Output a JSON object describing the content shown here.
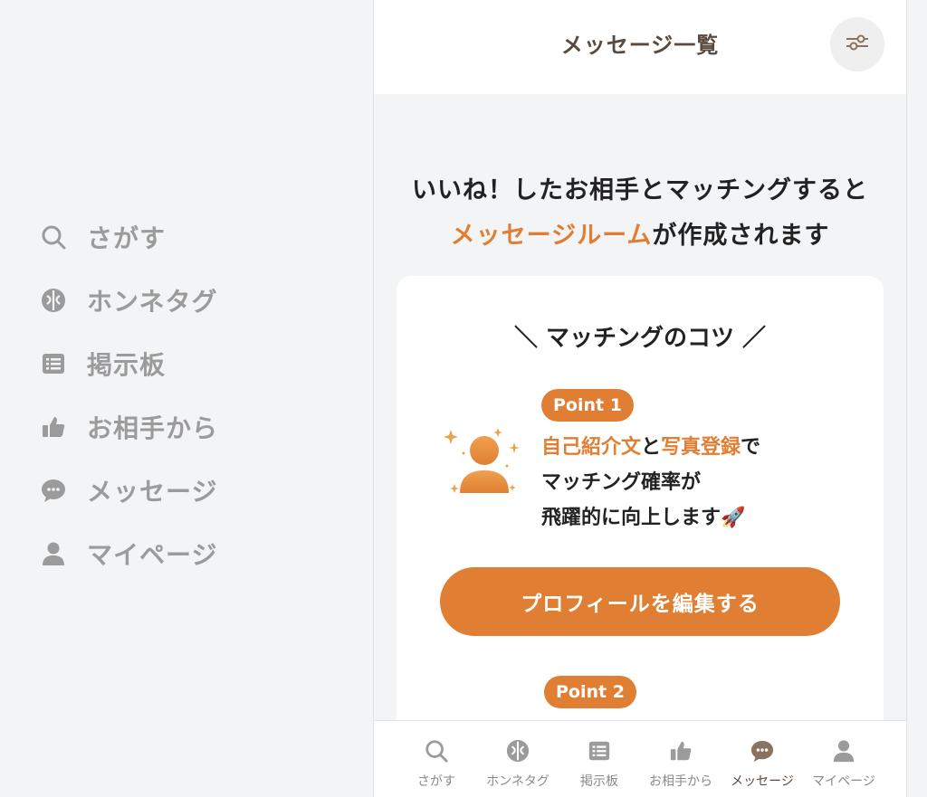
{
  "colors": {
    "accent": "#e07f34",
    "sidebar_text": "#9b9b9b",
    "brown": "#5a4a3e",
    "active_icon": "#8a7260"
  },
  "sidebar": {
    "items": [
      {
        "label": "さがす",
        "icon": "search-icon"
      },
      {
        "label": "ホンネタグ",
        "icon": "tag-icon"
      },
      {
        "label": "掲示板",
        "icon": "board-icon"
      },
      {
        "label": "お相手から",
        "icon": "thumbs-up-icon"
      },
      {
        "label": "メッセージ",
        "icon": "chat-icon"
      },
      {
        "label": "マイページ",
        "icon": "person-icon"
      }
    ]
  },
  "header": {
    "title": "メッセージ一覧",
    "filter_icon": "filter-sliders-icon"
  },
  "intro": {
    "line1": "いいね！したお相手とマッチングすると",
    "line2_accent": "メッセージルーム",
    "line2_rest": "が作成されます"
  },
  "card": {
    "heading": "＼ マッチングのコツ ／",
    "point1": {
      "badge": "Point 1",
      "accent1": "自己紹介文",
      "joiner": "と",
      "accent2": "写真登録",
      "suffix": "で",
      "line2": "マッチング確率が",
      "line3": "飛躍的に向上します🚀"
    },
    "edit_button": "プロフィールを編集する",
    "point2": {
      "badge": "Point 2"
    }
  },
  "tabbar": {
    "active": "メッセージ",
    "tabs": [
      {
        "label": "さがす",
        "icon": "search-icon"
      },
      {
        "label": "ホンネタグ",
        "icon": "tag-icon"
      },
      {
        "label": "掲示板",
        "icon": "board-icon"
      },
      {
        "label": "お相手から",
        "icon": "thumbs-up-icon"
      },
      {
        "label": "メッセージ",
        "icon": "chat-icon"
      },
      {
        "label": "マイページ",
        "icon": "person-icon"
      }
    ]
  }
}
